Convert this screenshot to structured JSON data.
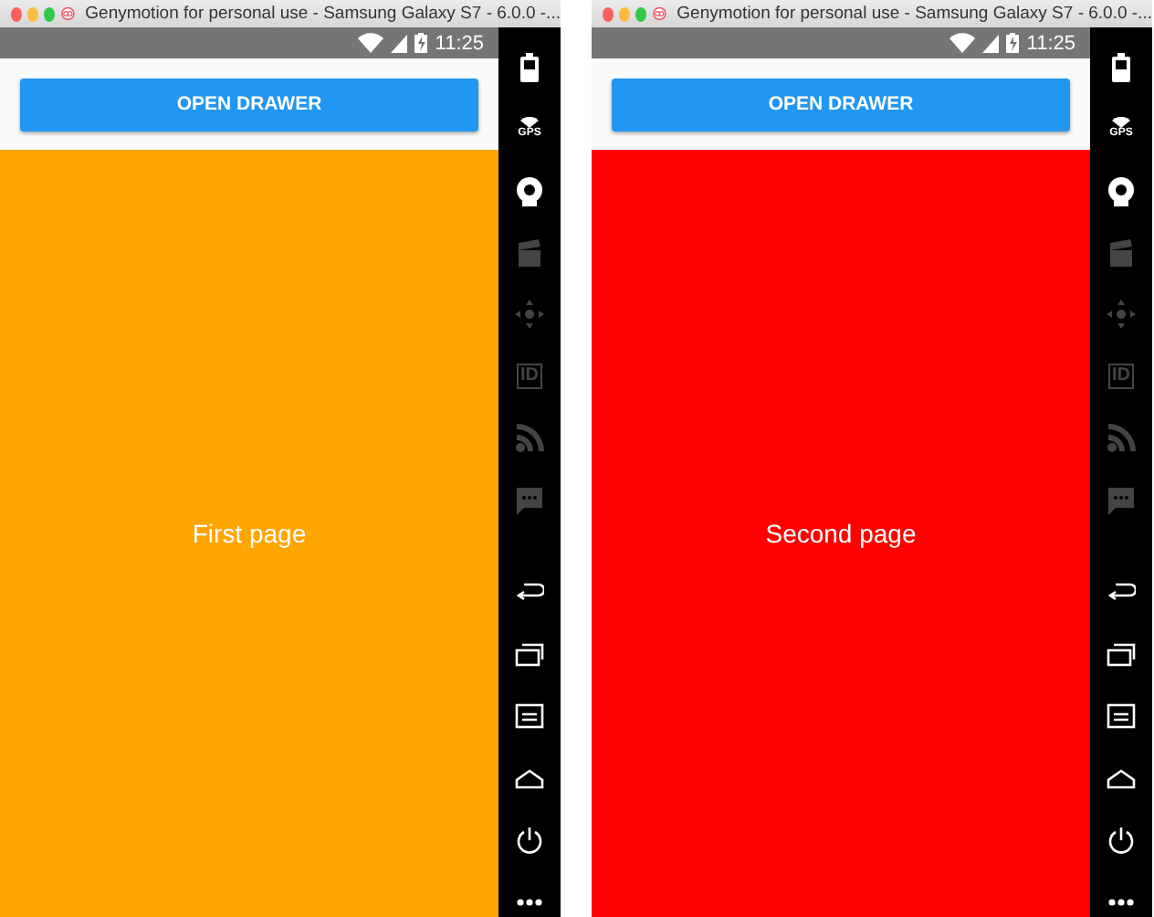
{
  "windows": [
    {
      "title": "Genymotion for personal use - Samsung Galaxy S7 - 6.0.0 -...",
      "time": "11:25",
      "button": "OPEN DRAWER",
      "page": {
        "label": "First page",
        "color": "#ffa500"
      },
      "sidebar": [
        {
          "kind": "battery",
          "disabled": false
        },
        {
          "kind": "gps",
          "label": "GPS",
          "disabled": false
        },
        {
          "kind": "camera",
          "disabled": false
        },
        {
          "kind": "clapper",
          "disabled": true
        },
        {
          "kind": "dpad",
          "disabled": true
        },
        {
          "kind": "id",
          "label": "ID",
          "disabled": true
        },
        {
          "kind": "rss",
          "disabled": true
        },
        {
          "kind": "sms",
          "disabled": true
        },
        {
          "kind": "back",
          "disabled": false
        },
        {
          "kind": "recent",
          "disabled": false
        },
        {
          "kind": "menu",
          "disabled": false
        },
        {
          "kind": "home",
          "disabled": false
        },
        {
          "kind": "power",
          "disabled": false
        },
        {
          "kind": "more",
          "disabled": false
        }
      ]
    },
    {
      "title": "Genymotion for personal use - Samsung Galaxy S7 - 6.0.0 -...",
      "time": "11:25",
      "button": "OPEN DRAWER",
      "page": {
        "label": "Second page",
        "color": "#ff0000"
      },
      "sidebar": [
        {
          "kind": "battery",
          "disabled": false
        },
        {
          "kind": "gps",
          "label": "GPS",
          "disabled": false
        },
        {
          "kind": "camera",
          "disabled": false
        },
        {
          "kind": "clapper",
          "disabled": true
        },
        {
          "kind": "dpad",
          "disabled": true
        },
        {
          "kind": "id",
          "label": "ID",
          "disabled": true
        },
        {
          "kind": "rss",
          "disabled": true
        },
        {
          "kind": "sms",
          "disabled": true
        },
        {
          "kind": "back",
          "disabled": false
        },
        {
          "kind": "recent",
          "disabled": false
        },
        {
          "kind": "menu",
          "disabled": false
        },
        {
          "kind": "home",
          "disabled": false
        },
        {
          "kind": "power",
          "disabled": false
        },
        {
          "kind": "more",
          "disabled": false
        }
      ]
    }
  ]
}
